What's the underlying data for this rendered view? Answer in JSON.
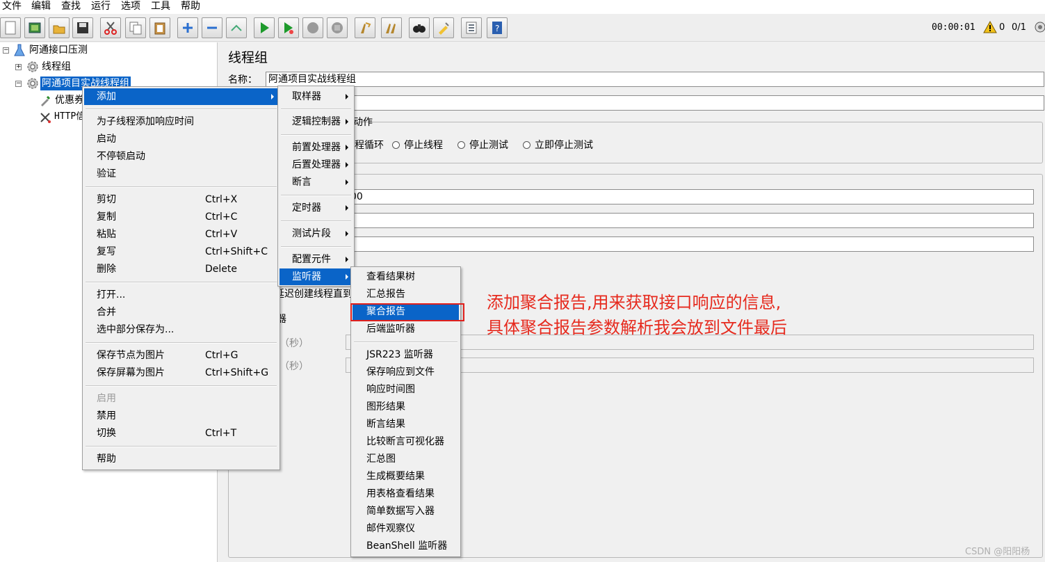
{
  "menubar": [
    "文件",
    "编辑",
    "查找",
    "运行",
    "选项",
    "工具",
    "帮助"
  ],
  "toolbar": {
    "buttons": [
      "new-icon",
      "templates-icon",
      "open-icon",
      "save-icon",
      "cut-icon",
      "copy-icon",
      "paste-icon",
      "expand-icon",
      "collapse-icon",
      "toggle-icon",
      "start-icon",
      "start-no-pause-icon",
      "stop-icon",
      "shutdown-icon",
      "clear-icon",
      "clear-all-icon",
      "search-icon",
      "reset-search-icon",
      "function-helper-icon",
      "help-icon"
    ],
    "timer": "00:00:01",
    "error_count": "0",
    "threads": "0/1"
  },
  "tree": {
    "root": "阿通接口压测",
    "n1": "线程组",
    "n2": "阿通项目实战线程组",
    "n3": "优惠券",
    "n4": "HTTP信"
  },
  "panel": {
    "title": "线程组",
    "name_label": "名称：",
    "name_value": "阿通项目实战线程组",
    "action_frag": "动作",
    "radio_loop_frag": "程循环",
    "radio_stop_thread": "停止线程",
    "radio_stop_test": "停止测试",
    "radio_stop_now": "立即停止测试",
    "field_frag": "00",
    "delay_frag": "延迟创建线程直到需要",
    "scheduler_frag": "器",
    "sec1": "（秒）",
    "sec2": "（秒）"
  },
  "menu1": {
    "add": "添加",
    "add_resp_time": "为子线程添加响应时间",
    "start": "启动",
    "start_no_pause": "不停顿启动",
    "validate": "验证",
    "cut": "剪切",
    "cut_sc": "Ctrl+X",
    "copy": "复制",
    "copy_sc": "Ctrl+C",
    "paste": "粘贴",
    "paste_sc": "Ctrl+V",
    "duplicate": "复写",
    "duplicate_sc": "Ctrl+Shift+C",
    "delete": "删除",
    "delete_sc": "Delete",
    "open": "打开...",
    "merge": "合并",
    "save_selection": "选中部分保存为...",
    "save_node_image": "保存节点为图片",
    "save_node_image_sc": "Ctrl+G",
    "save_screen_image": "保存屏幕为图片",
    "save_screen_image_sc": "Ctrl+Shift+G",
    "enable": "启用",
    "disable": "禁用",
    "toggle": "切换",
    "toggle_sc": "Ctrl+T",
    "help": "帮助"
  },
  "menu2": {
    "sampler": "取样器",
    "logic_controller": "逻辑控制器",
    "pre_processor": "前置处理器",
    "post_processor": "后置处理器",
    "assertion": "断言",
    "timer": "定时器",
    "test_fragment": "测试片段",
    "config_element": "配置元件",
    "listener": "监听器"
  },
  "menu3": [
    "查看结果树",
    "汇总报告",
    "聚合报告",
    "后端监听器",
    "JSR223 监听器",
    "保存响应到文件",
    "响应时间图",
    "图形结果",
    "断言结果",
    "比较断言可视化器",
    "汇总图",
    "生成概要结果",
    "用表格查看结果",
    "简单数据写入器",
    "邮件观察仪",
    "BeanShell 监听器"
  ],
  "annotation": {
    "line1": "添加聚合报告,用来获取接口响应的信息,",
    "line2": "具体聚合报告参数解析我会放到文件最后"
  },
  "watermark": "CSDN @阳阳杨",
  "colors": {
    "selection": "#0a64c8",
    "annotation": "#e62a1e"
  }
}
